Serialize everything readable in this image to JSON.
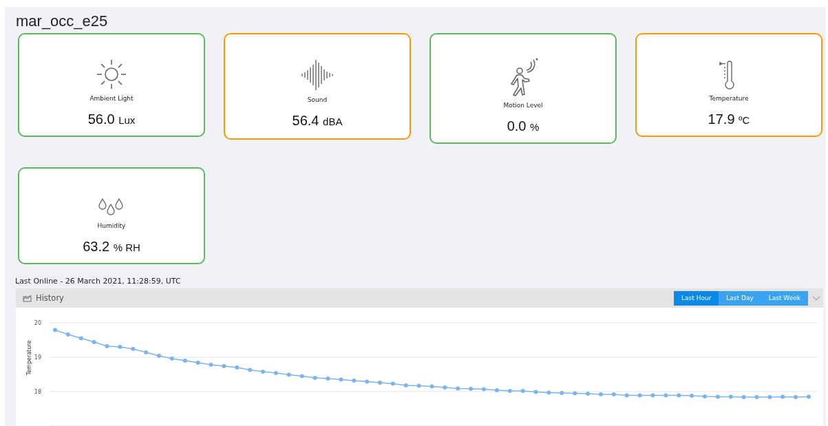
{
  "device": {
    "title": "mar_occ_e25"
  },
  "sensors": [
    {
      "kind": "light",
      "label": "Ambient Light",
      "value": "56.0",
      "unit": "Lux",
      "color": "#5cb85c"
    },
    {
      "kind": "sound",
      "label": "Sound",
      "value": "56.4",
      "unit": "dBA",
      "color": "#ff9900"
    },
    {
      "kind": "motion",
      "label": "Motion Level",
      "value": "0.0",
      "unit": "%",
      "color": "#5cb85c"
    },
    {
      "kind": "temperature",
      "label": "Temperature",
      "value": "17.9",
      "unit": "ºC",
      "color": "#ff9900"
    },
    {
      "kind": "humidity",
      "label": "Humidity",
      "value": "63.2",
      "unit": "% RH",
      "color": "#5cb85c"
    }
  ],
  "last_online": "Last Online - 26 March 2021, 11:28:59, UTC",
  "history": {
    "title": "History",
    "ranges": [
      {
        "label": "Last Hour",
        "selected": true
      },
      {
        "label": "Last Day",
        "selected": false
      },
      {
        "label": "Last Week",
        "selected": false
      }
    ],
    "chart_data": {
      "type": "line",
      "ylabel": "Temperature",
      "ylim": [
        17,
        20
      ],
      "yticks": [
        18,
        19,
        20
      ],
      "series": [
        {
          "color": "#7cb5ec",
          "marker": true,
          "values": [
            19.79,
            19.66,
            19.55,
            19.44,
            19.32,
            19.3,
            19.24,
            19.14,
            19.04,
            18.96,
            18.9,
            18.84,
            18.78,
            18.74,
            18.7,
            18.63,
            18.58,
            18.54,
            18.49,
            18.45,
            18.4,
            18.38,
            18.35,
            18.32,
            18.29,
            18.26,
            18.23,
            18.18,
            18.17,
            18.15,
            18.12,
            18.09,
            18.08,
            18.07,
            18.04,
            18.02,
            18.02,
            17.99,
            17.97,
            17.96,
            17.95,
            17.94,
            17.92,
            17.92,
            17.89,
            17.89,
            17.89,
            17.89,
            17.89,
            17.88,
            17.86,
            17.85,
            17.85,
            17.84,
            17.84,
            17.84,
            17.85,
            17.84,
            17.85
          ]
        }
      ]
    }
  }
}
